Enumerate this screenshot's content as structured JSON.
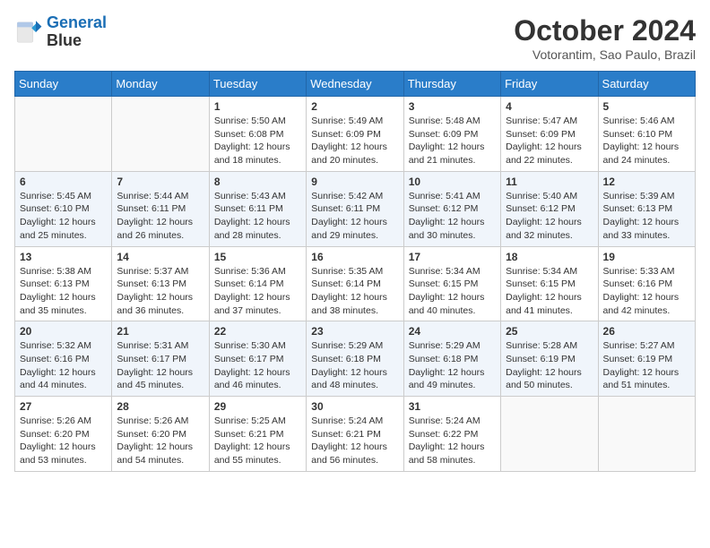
{
  "header": {
    "logo": {
      "line1": "General",
      "line2": "Blue"
    },
    "title": "October 2024",
    "location": "Votorantim, Sao Paulo, Brazil"
  },
  "days_of_week": [
    "Sunday",
    "Monday",
    "Tuesday",
    "Wednesday",
    "Thursday",
    "Friday",
    "Saturday"
  ],
  "weeks": [
    [
      {
        "day": "",
        "sunrise": "",
        "sunset": "",
        "daylight": ""
      },
      {
        "day": "",
        "sunrise": "",
        "sunset": "",
        "daylight": ""
      },
      {
        "day": "1",
        "sunrise": "Sunrise: 5:50 AM",
        "sunset": "Sunset: 6:08 PM",
        "daylight": "Daylight: 12 hours and 18 minutes."
      },
      {
        "day": "2",
        "sunrise": "Sunrise: 5:49 AM",
        "sunset": "Sunset: 6:09 PM",
        "daylight": "Daylight: 12 hours and 20 minutes."
      },
      {
        "day": "3",
        "sunrise": "Sunrise: 5:48 AM",
        "sunset": "Sunset: 6:09 PM",
        "daylight": "Daylight: 12 hours and 21 minutes."
      },
      {
        "day": "4",
        "sunrise": "Sunrise: 5:47 AM",
        "sunset": "Sunset: 6:09 PM",
        "daylight": "Daylight: 12 hours and 22 minutes."
      },
      {
        "day": "5",
        "sunrise": "Sunrise: 5:46 AM",
        "sunset": "Sunset: 6:10 PM",
        "daylight": "Daylight: 12 hours and 24 minutes."
      }
    ],
    [
      {
        "day": "6",
        "sunrise": "Sunrise: 5:45 AM",
        "sunset": "Sunset: 6:10 PM",
        "daylight": "Daylight: 12 hours and 25 minutes."
      },
      {
        "day": "7",
        "sunrise": "Sunrise: 5:44 AM",
        "sunset": "Sunset: 6:11 PM",
        "daylight": "Daylight: 12 hours and 26 minutes."
      },
      {
        "day": "8",
        "sunrise": "Sunrise: 5:43 AM",
        "sunset": "Sunset: 6:11 PM",
        "daylight": "Daylight: 12 hours and 28 minutes."
      },
      {
        "day": "9",
        "sunrise": "Sunrise: 5:42 AM",
        "sunset": "Sunset: 6:11 PM",
        "daylight": "Daylight: 12 hours and 29 minutes."
      },
      {
        "day": "10",
        "sunrise": "Sunrise: 5:41 AM",
        "sunset": "Sunset: 6:12 PM",
        "daylight": "Daylight: 12 hours and 30 minutes."
      },
      {
        "day": "11",
        "sunrise": "Sunrise: 5:40 AM",
        "sunset": "Sunset: 6:12 PM",
        "daylight": "Daylight: 12 hours and 32 minutes."
      },
      {
        "day": "12",
        "sunrise": "Sunrise: 5:39 AM",
        "sunset": "Sunset: 6:13 PM",
        "daylight": "Daylight: 12 hours and 33 minutes."
      }
    ],
    [
      {
        "day": "13",
        "sunrise": "Sunrise: 5:38 AM",
        "sunset": "Sunset: 6:13 PM",
        "daylight": "Daylight: 12 hours and 35 minutes."
      },
      {
        "day": "14",
        "sunrise": "Sunrise: 5:37 AM",
        "sunset": "Sunset: 6:13 PM",
        "daylight": "Daylight: 12 hours and 36 minutes."
      },
      {
        "day": "15",
        "sunrise": "Sunrise: 5:36 AM",
        "sunset": "Sunset: 6:14 PM",
        "daylight": "Daylight: 12 hours and 37 minutes."
      },
      {
        "day": "16",
        "sunrise": "Sunrise: 5:35 AM",
        "sunset": "Sunset: 6:14 PM",
        "daylight": "Daylight: 12 hours and 38 minutes."
      },
      {
        "day": "17",
        "sunrise": "Sunrise: 5:34 AM",
        "sunset": "Sunset: 6:15 PM",
        "daylight": "Daylight: 12 hours and 40 minutes."
      },
      {
        "day": "18",
        "sunrise": "Sunrise: 5:34 AM",
        "sunset": "Sunset: 6:15 PM",
        "daylight": "Daylight: 12 hours and 41 minutes."
      },
      {
        "day": "19",
        "sunrise": "Sunrise: 5:33 AM",
        "sunset": "Sunset: 6:16 PM",
        "daylight": "Daylight: 12 hours and 42 minutes."
      }
    ],
    [
      {
        "day": "20",
        "sunrise": "Sunrise: 5:32 AM",
        "sunset": "Sunset: 6:16 PM",
        "daylight": "Daylight: 12 hours and 44 minutes."
      },
      {
        "day": "21",
        "sunrise": "Sunrise: 5:31 AM",
        "sunset": "Sunset: 6:17 PM",
        "daylight": "Daylight: 12 hours and 45 minutes."
      },
      {
        "day": "22",
        "sunrise": "Sunrise: 5:30 AM",
        "sunset": "Sunset: 6:17 PM",
        "daylight": "Daylight: 12 hours and 46 minutes."
      },
      {
        "day": "23",
        "sunrise": "Sunrise: 5:29 AM",
        "sunset": "Sunset: 6:18 PM",
        "daylight": "Daylight: 12 hours and 48 minutes."
      },
      {
        "day": "24",
        "sunrise": "Sunrise: 5:29 AM",
        "sunset": "Sunset: 6:18 PM",
        "daylight": "Daylight: 12 hours and 49 minutes."
      },
      {
        "day": "25",
        "sunrise": "Sunrise: 5:28 AM",
        "sunset": "Sunset: 6:19 PM",
        "daylight": "Daylight: 12 hours and 50 minutes."
      },
      {
        "day": "26",
        "sunrise": "Sunrise: 5:27 AM",
        "sunset": "Sunset: 6:19 PM",
        "daylight": "Daylight: 12 hours and 51 minutes."
      }
    ],
    [
      {
        "day": "27",
        "sunrise": "Sunrise: 5:26 AM",
        "sunset": "Sunset: 6:20 PM",
        "daylight": "Daylight: 12 hours and 53 minutes."
      },
      {
        "day": "28",
        "sunrise": "Sunrise: 5:26 AM",
        "sunset": "Sunset: 6:20 PM",
        "daylight": "Daylight: 12 hours and 54 minutes."
      },
      {
        "day": "29",
        "sunrise": "Sunrise: 5:25 AM",
        "sunset": "Sunset: 6:21 PM",
        "daylight": "Daylight: 12 hours and 55 minutes."
      },
      {
        "day": "30",
        "sunrise": "Sunrise: 5:24 AM",
        "sunset": "Sunset: 6:21 PM",
        "daylight": "Daylight: 12 hours and 56 minutes."
      },
      {
        "day": "31",
        "sunrise": "Sunrise: 5:24 AM",
        "sunset": "Sunset: 6:22 PM",
        "daylight": "Daylight: 12 hours and 58 minutes."
      },
      {
        "day": "",
        "sunrise": "",
        "sunset": "",
        "daylight": ""
      },
      {
        "day": "",
        "sunrise": "",
        "sunset": "",
        "daylight": ""
      }
    ]
  ]
}
